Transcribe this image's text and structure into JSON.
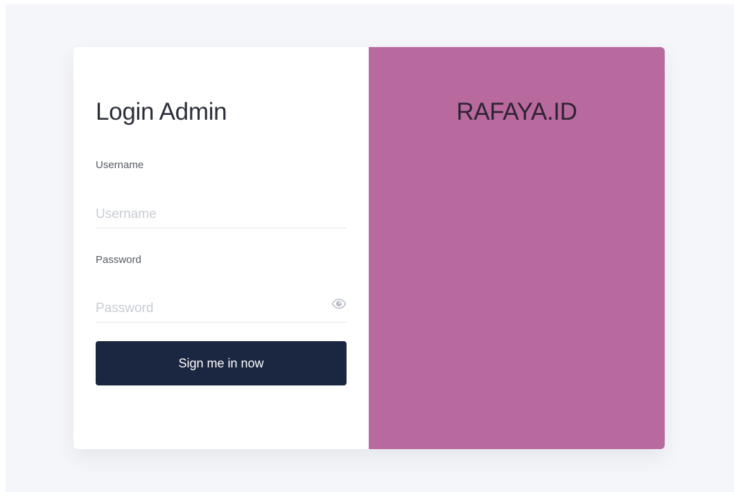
{
  "login": {
    "title": "Login Admin",
    "username": {
      "label": "Username",
      "placeholder": "Username",
      "value": ""
    },
    "password": {
      "label": "Password",
      "placeholder": "Password",
      "value": "",
      "toggle_icon": "eye-icon"
    },
    "submit_label": "Sign me in now"
  },
  "brand": {
    "name": "RAFAYA.ID"
  },
  "colors": {
    "page_background": "#f5f6fa",
    "card_background": "#ffffff",
    "brand_panel": "#b8699e",
    "primary_button": "#1b2640",
    "button_text": "#ffffff",
    "placeholder_text": "#c8ccd4"
  }
}
